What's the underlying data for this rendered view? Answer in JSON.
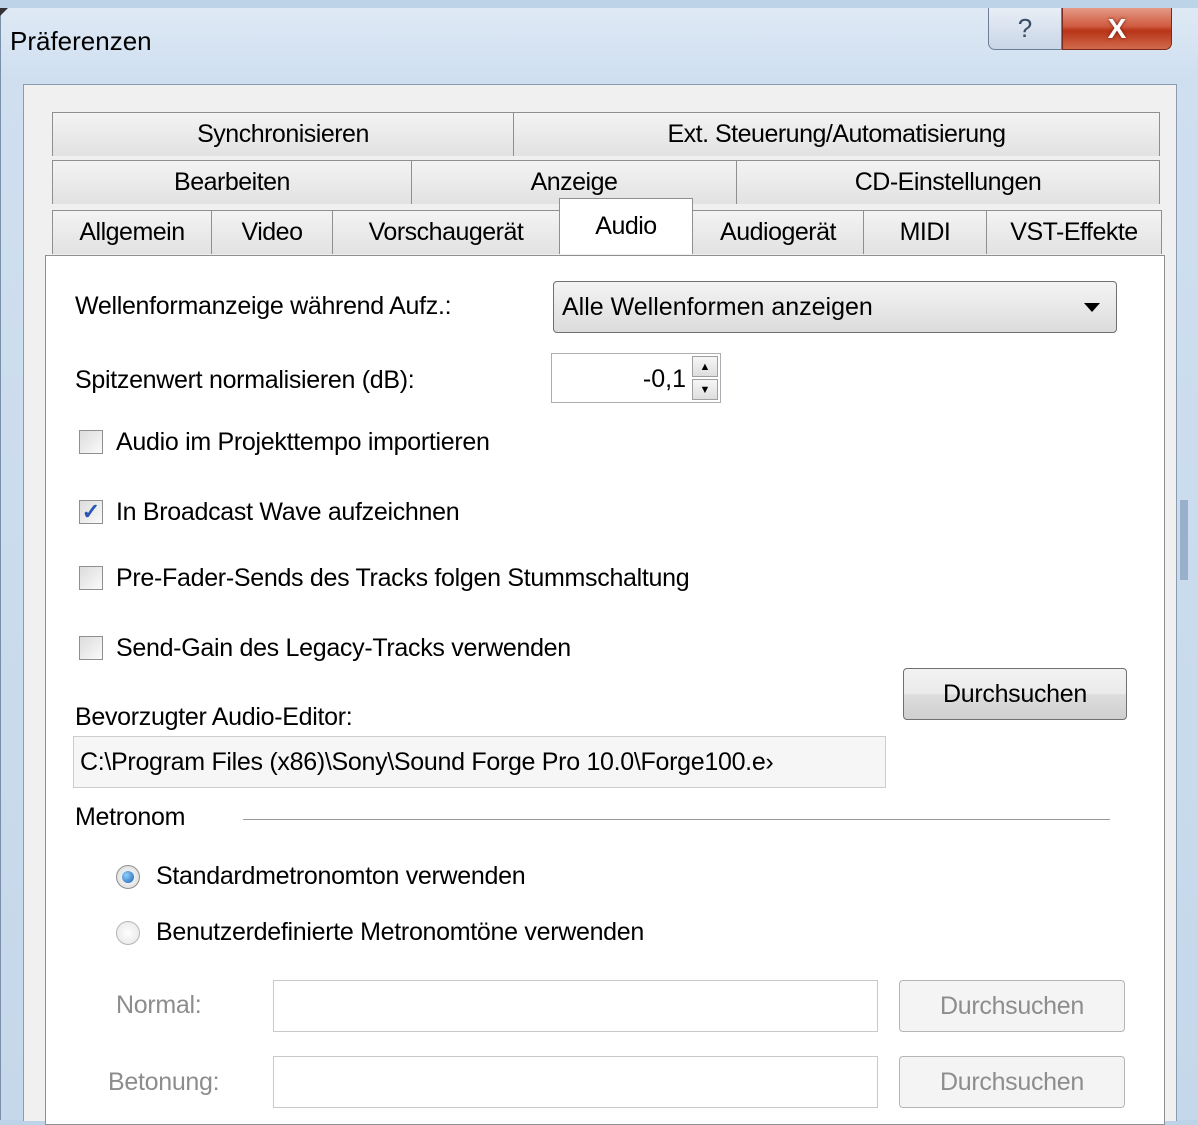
{
  "window": {
    "title": "Präferenzen",
    "help_label": "?",
    "close_label": "X"
  },
  "tabs": {
    "row1": [
      "Synchronisieren",
      "Ext. Steuerung/Automatisierung"
    ],
    "row2": [
      "Bearbeiten",
      "Anzeige",
      "CD-Einstellungen"
    ],
    "row3": [
      "Allgemein",
      "Video",
      "Vorschaugerät",
      "Audio",
      "Audiogerät",
      "MIDI",
      "VST-Effekte"
    ],
    "selected": "Audio"
  },
  "audio": {
    "waveform_label": "Wellenformanzeige während Aufz.:",
    "waveform_value": "Alle Wellenformen anzeigen",
    "normalize_label": "Spitzenwert normalisieren (dB):",
    "normalize_value": "-0,1",
    "checkboxes": [
      {
        "label": "Audio im Projekttempo importieren",
        "checked": false
      },
      {
        "label": "In Broadcast Wave aufzeichnen",
        "checked": true
      },
      {
        "label": "Pre-Fader-Sends des Tracks folgen Stummschaltung",
        "checked": false
      },
      {
        "label": "Send-Gain des Legacy-Tracks verwenden",
        "checked": false
      }
    ],
    "editor_label": "Bevorzugter Audio-Editor:",
    "editor_path": "C:\\Program Files (x86)\\Sony\\Sound Forge Pro 10.0\\Forge100.e›",
    "browse_label": "Durchsuchen",
    "check_glyph": "✓"
  },
  "metronome": {
    "group_label": "Metronom",
    "radios": [
      {
        "label": "Standardmetronomton verwenden",
        "selected": true
      },
      {
        "label": "Benutzerdefinierte Metronomtöne verwenden",
        "selected": false
      }
    ],
    "normal_label": "Normal:",
    "normal_value": "",
    "accent_label": "Betonung:",
    "accent_value": "",
    "browse_label": "Durchsuchen"
  }
}
